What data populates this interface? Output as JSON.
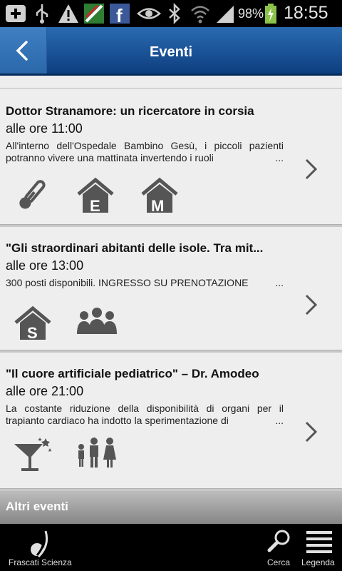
{
  "status_bar": {
    "battery_percent": "98%",
    "time": "18:55",
    "icons": [
      "add-icon",
      "usb-icon",
      "warning-icon",
      "app-icon",
      "facebook-icon",
      "eye-icon",
      "bluetooth-icon",
      "wifi-icon",
      "signal-icon",
      "battery-charging-icon"
    ]
  },
  "header": {
    "title": "Eventi",
    "back_icon": "chevron-left-icon"
  },
  "events": [
    {
      "title": "Dottor Stranamore: un ricercatore in corsia",
      "time": "alle ore 11:00",
      "description": "All'interno dell'Ospedale Bambino Gesù, i piccoli pazienti potranno vivere una mattinata invertendo i ruoli",
      "ellipsis": "...",
      "icons": [
        "thermometer-icon",
        "house-e-icon",
        "house-m-icon"
      ]
    },
    {
      "title": "\"Gli straordinari abitanti delle isole. Tra mit...",
      "time": "alle ore 13:00",
      "description": "300 posti disponibili. INGRESSO SU PRENOTAZIONE",
      "ellipsis": "...",
      "icons": [
        "house-s-icon",
        "group-icon"
      ]
    },
    {
      "title": "\"Il cuore artificiale pediatrico\" – Dr. Amodeo",
      "time": "alle ore 21:00",
      "description": "La costante riduzione della disponibilità di organi per il trapianto cardiaco ha indotto la sperimentazione di",
      "ellipsis": "...",
      "icons": [
        "cocktail-icon",
        "family-icon"
      ]
    }
  ],
  "altri_eventi": "Altri eventi",
  "bottom_bar": {
    "app_name": "Frascati Scienza",
    "search_label": "Cerca",
    "legend_label": "Legenda"
  },
  "colors": {
    "header_top": "#2a6ab0",
    "header_bottom": "#0d3f80",
    "icon_gray": "#555555",
    "background": "#eeeeee"
  }
}
